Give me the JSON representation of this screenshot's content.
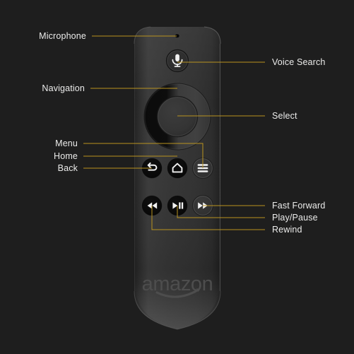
{
  "diagram": {
    "title": "Amazon Fire TV Voice Remote callout diagram",
    "background_color": "#1e1e1e",
    "leader_line_color": "#b9931f",
    "label_color": "#ececeb",
    "device_body_color": "#303030"
  },
  "device": {
    "brand_wordmark": "amazon"
  },
  "labels": {
    "microphone": "Microphone",
    "navigation": "Navigation",
    "menu": "Menu",
    "home": "Home",
    "back": "Back",
    "voice_search": "Voice Search",
    "select": "Select",
    "fast_forward": "Fast Forward",
    "play_pause": "Play/Pause",
    "rewind": "Rewind"
  },
  "parts": [
    {
      "id": "microphone",
      "label": "Microphone",
      "side": "left",
      "icon": "microphone-hole-icon"
    },
    {
      "id": "navigation",
      "label": "Navigation",
      "side": "left",
      "icon": "navigation-ring-icon"
    },
    {
      "id": "menu",
      "label": "Menu",
      "side": "left",
      "icon": "menu-icon"
    },
    {
      "id": "home",
      "label": "Home",
      "side": "left",
      "icon": "home-icon"
    },
    {
      "id": "back",
      "label": "Back",
      "side": "left",
      "icon": "back-arrow-icon"
    },
    {
      "id": "voice_search",
      "label": "Voice Search",
      "side": "right",
      "icon": "microphone-icon"
    },
    {
      "id": "select",
      "label": "Select",
      "side": "right",
      "icon": "select-button-icon"
    },
    {
      "id": "fast_forward",
      "label": "Fast Forward",
      "side": "right",
      "icon": "fast-forward-icon"
    },
    {
      "id": "play_pause",
      "label": "Play/Pause",
      "side": "right",
      "icon": "play-pause-icon"
    },
    {
      "id": "rewind",
      "label": "Rewind",
      "side": "right",
      "icon": "rewind-icon"
    }
  ]
}
